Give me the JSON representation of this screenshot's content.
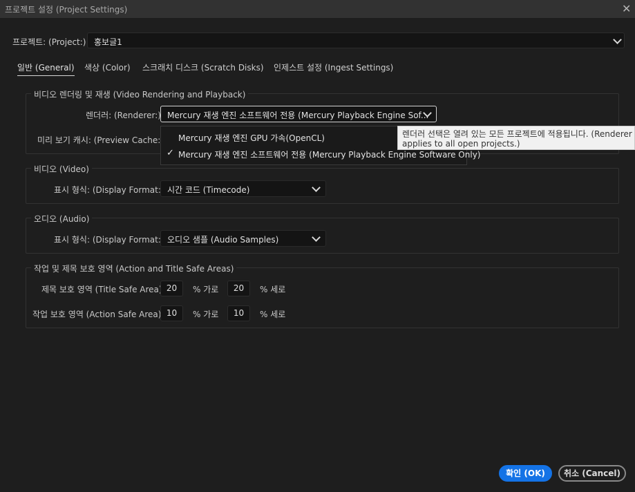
{
  "window": {
    "title": "프로젝트 설정 (Project Settings)",
    "close_glyph": "✕"
  },
  "project": {
    "label": "프로젝트: (Project:)",
    "value": "홍보글1"
  },
  "tabs": [
    {
      "label": "일반 (General)",
      "active": true
    },
    {
      "label": "색상 (Color)",
      "active": false
    },
    {
      "label": "스크래치 디스크 (Scratch Disks)",
      "active": false
    },
    {
      "label": "인제스트 설정 (Ingest Settings)",
      "active": false
    }
  ],
  "video_rendering": {
    "legend": "비디오 렌더링 및 재생 (Video Rendering and Playback)",
    "renderer_label": "렌더러: (Renderer:)",
    "renderer_value": "Mercury 재생 엔진 소프트웨어 전용 (Mercury Playback Engine Sof...",
    "preview_cache_label": "미리 보기 캐시: (Preview Cache:)",
    "renderer_options": [
      {
        "label": "Mercury 재생 엔진 GPU 가속(OpenCL)",
        "selected": false
      },
      {
        "label": "Mercury 재생 엔진 소프트웨어 전용 (Mercury Playback Engine Software Only)",
        "selected": true
      }
    ],
    "check_glyph": "✓",
    "tooltip_line1": "렌더러 선택은 열려 있는 모든 프로젝트에 적용됩니다. (Renderer selection",
    "tooltip_line2": "applies to all open projects.)"
  },
  "video": {
    "legend": "비디오 (Video)",
    "display_format_label": "표시 형식: (Display Format:)",
    "display_format_value": "시간 코드 (Timecode)"
  },
  "audio": {
    "legend": "오디오 (Audio)",
    "display_format_label": "표시 형식: (Display Format:)",
    "display_format_value": "오디오 샘플 (Audio Samples)"
  },
  "safe_areas": {
    "legend": "작업 및 제목 보호 영역 (Action and Title Safe Areas)",
    "title_label": "제목 보호 영역 (Title Safe Area)",
    "title_h": "20",
    "title_v": "20",
    "action_label": "작업 보호 영역 (Action Safe Area)",
    "action_h": "10",
    "action_v": "10",
    "horizontal_unit": "% 가로",
    "vertical_unit": "% 세로"
  },
  "buttons": {
    "ok": "확인 (OK)",
    "cancel": "취소 (Cancel)"
  },
  "colors": {
    "accent": "#1473e6",
    "background": "#1e1e1e",
    "tooltip_bg": "#f1f1f1"
  }
}
